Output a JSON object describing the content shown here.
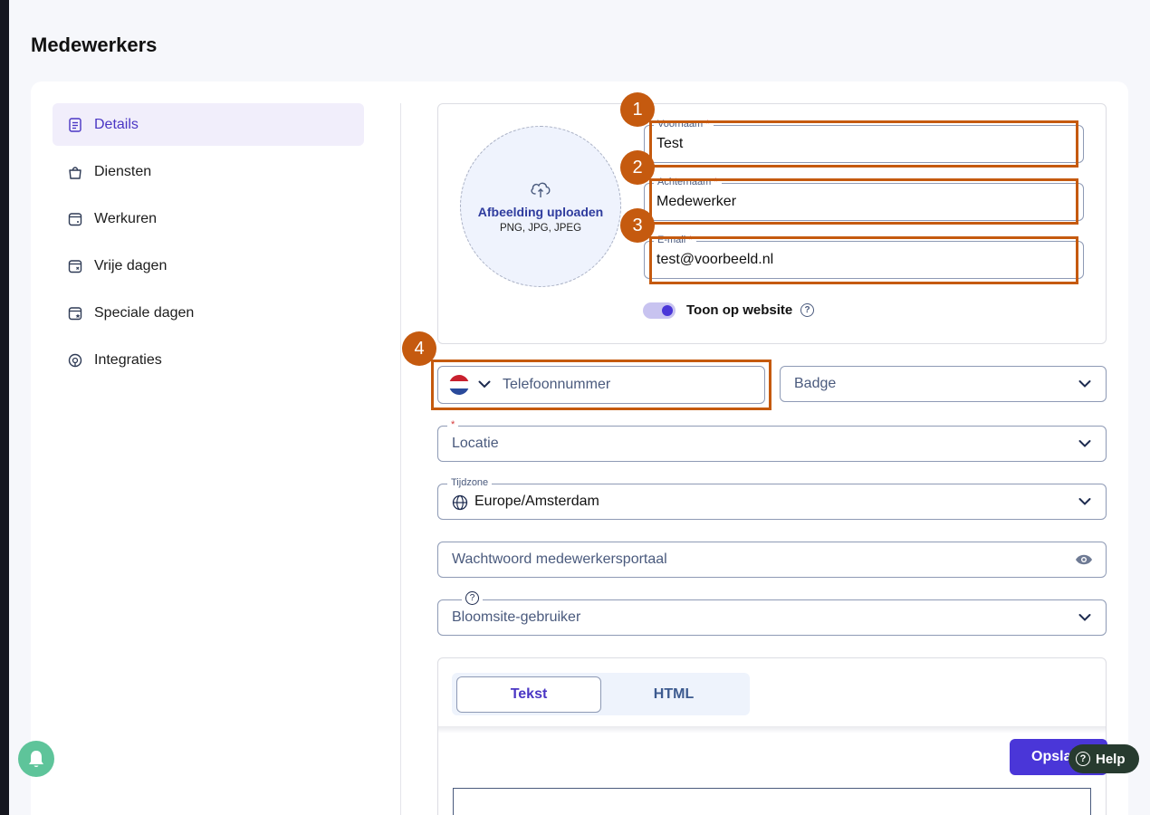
{
  "page": {
    "title": "Medewerkers"
  },
  "sidebar": {
    "items": [
      {
        "label": "Details",
        "icon": "document-icon",
        "active": true
      },
      {
        "label": "Diensten",
        "icon": "bag-icon"
      },
      {
        "label": "Werkuren",
        "icon": "calendar-icon"
      },
      {
        "label": "Vrije dagen",
        "icon": "calendar-x-icon"
      },
      {
        "label": "Speciale dagen",
        "icon": "calendar-star-icon"
      },
      {
        "label": "Integraties",
        "icon": "integration-icon"
      }
    ]
  },
  "upload": {
    "title": "Afbeelding uploaden",
    "formats": "PNG, JPG, JPEG"
  },
  "form": {
    "first_name": {
      "label": "Voornaam",
      "required": "*",
      "value": "Test"
    },
    "last_name": {
      "label": "Achternaam",
      "required": "*",
      "value": "Medewerker"
    },
    "email": {
      "label": "E-mail",
      "required": "*",
      "value": "test@voorbeeld.nl"
    },
    "show_on_website": {
      "label": "Toon op website",
      "help": "?",
      "enabled": true
    },
    "phone": {
      "placeholder": "Telefoonnummer",
      "country": "NL"
    },
    "badge": {
      "placeholder": "Badge"
    },
    "location": {
      "required": "*",
      "placeholder": "Locatie"
    },
    "timezone": {
      "label": "Tijdzone",
      "value": "Europe/Amsterdam"
    },
    "password": {
      "placeholder": "Wachtwoord medewerkersportaal"
    },
    "bloomsite_user": {
      "help": "?",
      "placeholder": "Bloomsite-gebruiker"
    }
  },
  "editor": {
    "tabs": [
      "Tekst",
      "HTML"
    ],
    "active_tab": "Tekst"
  },
  "annotations": [
    "1",
    "2",
    "3",
    "4"
  ],
  "actions": {
    "save": "Opsla",
    "help": "Help",
    "help_icon": "?"
  },
  "colors": {
    "accent": "#4a36d8",
    "highlight": "#c55a0f",
    "help_bg": "#273b2f",
    "bell_bg": "#5ec49a"
  }
}
